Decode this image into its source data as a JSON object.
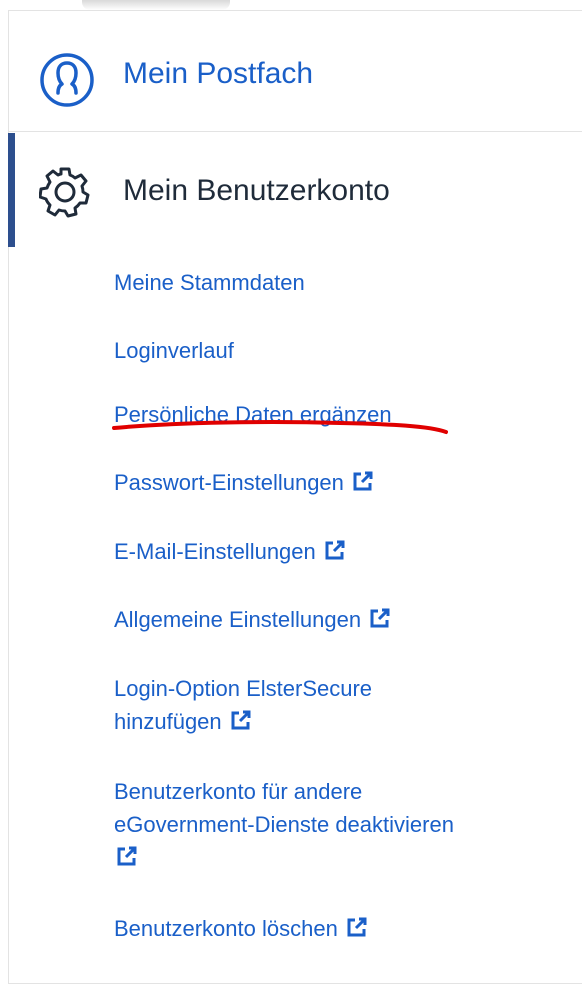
{
  "menu": {
    "postfach": {
      "label": "Mein Postfach",
      "icon": "user-circle-icon"
    },
    "benutzerkonto": {
      "label": "Mein Benutzerkonto",
      "icon": "gear-icon",
      "active_color": "#2d4f8e"
    },
    "submenu": [
      {
        "label": "Meine Stammdaten"
      },
      {
        "label": "Loginverlauf"
      },
      {
        "label": "Persönliche Daten ergänzen",
        "annotated": true
      },
      {
        "label": "Passwort-Einstellungen",
        "external": true
      },
      {
        "label": "E-Mail-Einstellungen",
        "external": true
      },
      {
        "label": "Allgemeine Einstellungen",
        "external": true
      },
      {
        "label_line1": "Login-Option ElsterSecure",
        "label_line2": "hinzufügen",
        "external": true
      },
      {
        "label_line1": "Benutzerkonto für andere",
        "label_line2": "eGovernment-Dienste deaktivieren",
        "external": true
      },
      {
        "label": "Benutzerkonto löschen",
        "external": true
      }
    ]
  },
  "colors": {
    "link": "#1a5fc8",
    "heading": "#1f2b3a",
    "annotation": "#e00000"
  }
}
